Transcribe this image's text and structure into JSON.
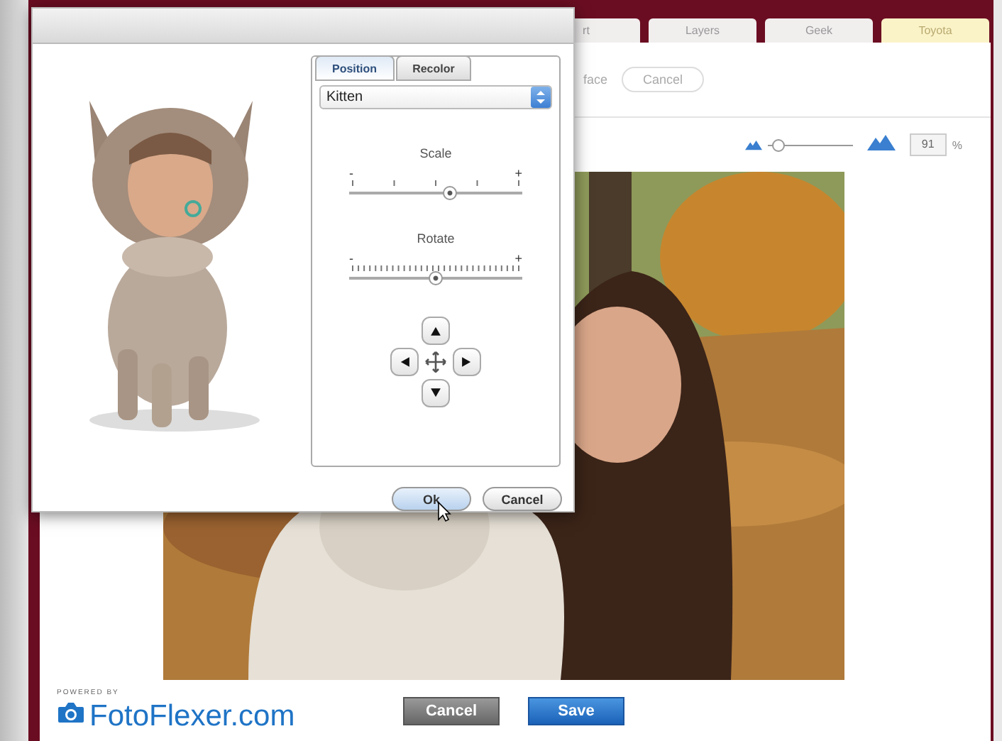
{
  "tabs": [
    {
      "label": "rt",
      "highlighted": false
    },
    {
      "label": "Layers",
      "highlighted": false
    },
    {
      "label": "Geek",
      "highlighted": false
    },
    {
      "label": "Toyota",
      "highlighted": true
    }
  ],
  "toolbar": {
    "label": "face",
    "cancel_button": "Cancel"
  },
  "zoom": {
    "level": 0.12,
    "value": "91",
    "unit": "%"
  },
  "dialog": {
    "tabs": [
      {
        "label": "Position",
        "selected": true
      },
      {
        "label": "Recolor",
        "selected": false
      }
    ],
    "select": {
      "value": "Kitten"
    },
    "sliders": [
      {
        "label": "Scale",
        "kind": "coarse",
        "min_label": "-",
        "max_label": "+",
        "level": 0.58
      },
      {
        "label": "Rotate",
        "kind": "fine",
        "min_label": "-",
        "max_label": "+",
        "level": 0.5
      }
    ],
    "buttons": [
      {
        "label": "Ok",
        "kind": "primary"
      },
      {
        "label": "Cancel",
        "kind": "secondary"
      }
    ]
  },
  "footer": {
    "powered_by": "POWERED BY",
    "logo": "FotoFlexer.com",
    "buttons": [
      {
        "label": "Cancel",
        "kind": "neutral"
      },
      {
        "label": "Save",
        "kind": "primary"
      }
    ]
  }
}
